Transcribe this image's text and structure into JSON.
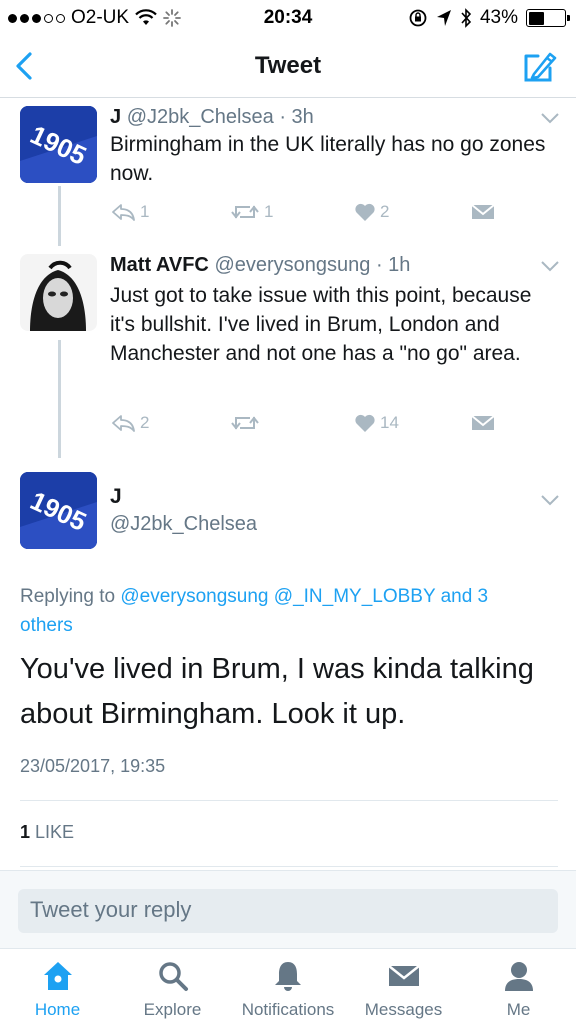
{
  "status_bar": {
    "carrier": "O2-UK",
    "time": "20:34",
    "battery": "43%",
    "battery_level": 0.43
  },
  "nav": {
    "title": "Tweet"
  },
  "tweets": [
    {
      "name": "J",
      "handle": "@J2bk_Chelsea",
      "time": "· 3h",
      "text": "Birmingham in the UK literally has no go zones now.",
      "replies": "1",
      "retweets": "1",
      "likes": "2"
    },
    {
      "name": "Matt AVFC",
      "handle": "@everysongsung",
      "time": "· 1h",
      "text": "Just got to take issue with this point, because it's bullshit. I've lived in Brum, London and Manchester and not one has a \"no go\" area.",
      "replies": "2",
      "retweets": "",
      "likes": "14"
    }
  ],
  "main_tweet": {
    "name": "J",
    "handle": "@J2bk_Chelsea",
    "replying_prefix": "Replying to",
    "replying_to_1": "@everysongsung",
    "replying_to_2": "@_IN_MY_LOBBY",
    "replying_suffix": "and 3 others",
    "text": "You've lived in Brum, I was kinda talking about Birmingham. Look it up.",
    "timestamp": "23/05/2017, 19:35",
    "like_count": "1",
    "like_label": "LIKE"
  },
  "reply_box": {
    "placeholder": "Tweet your reply"
  },
  "tab_bar": {
    "tabs": [
      {
        "label": "Home",
        "icon": "home-icon"
      },
      {
        "label": "Explore",
        "icon": "search-icon"
      },
      {
        "label": "Notifications",
        "icon": "bell-icon"
      },
      {
        "label": "Messages",
        "icon": "envelope-icon"
      },
      {
        "label": "Me",
        "icon": "person-icon"
      }
    ]
  },
  "colors": {
    "accent": "#1da1f2",
    "muted": "#657786",
    "action_gray": "#aab8c2",
    "chelsea_blue": "#1b3fb0"
  },
  "avatar_text": "1905"
}
